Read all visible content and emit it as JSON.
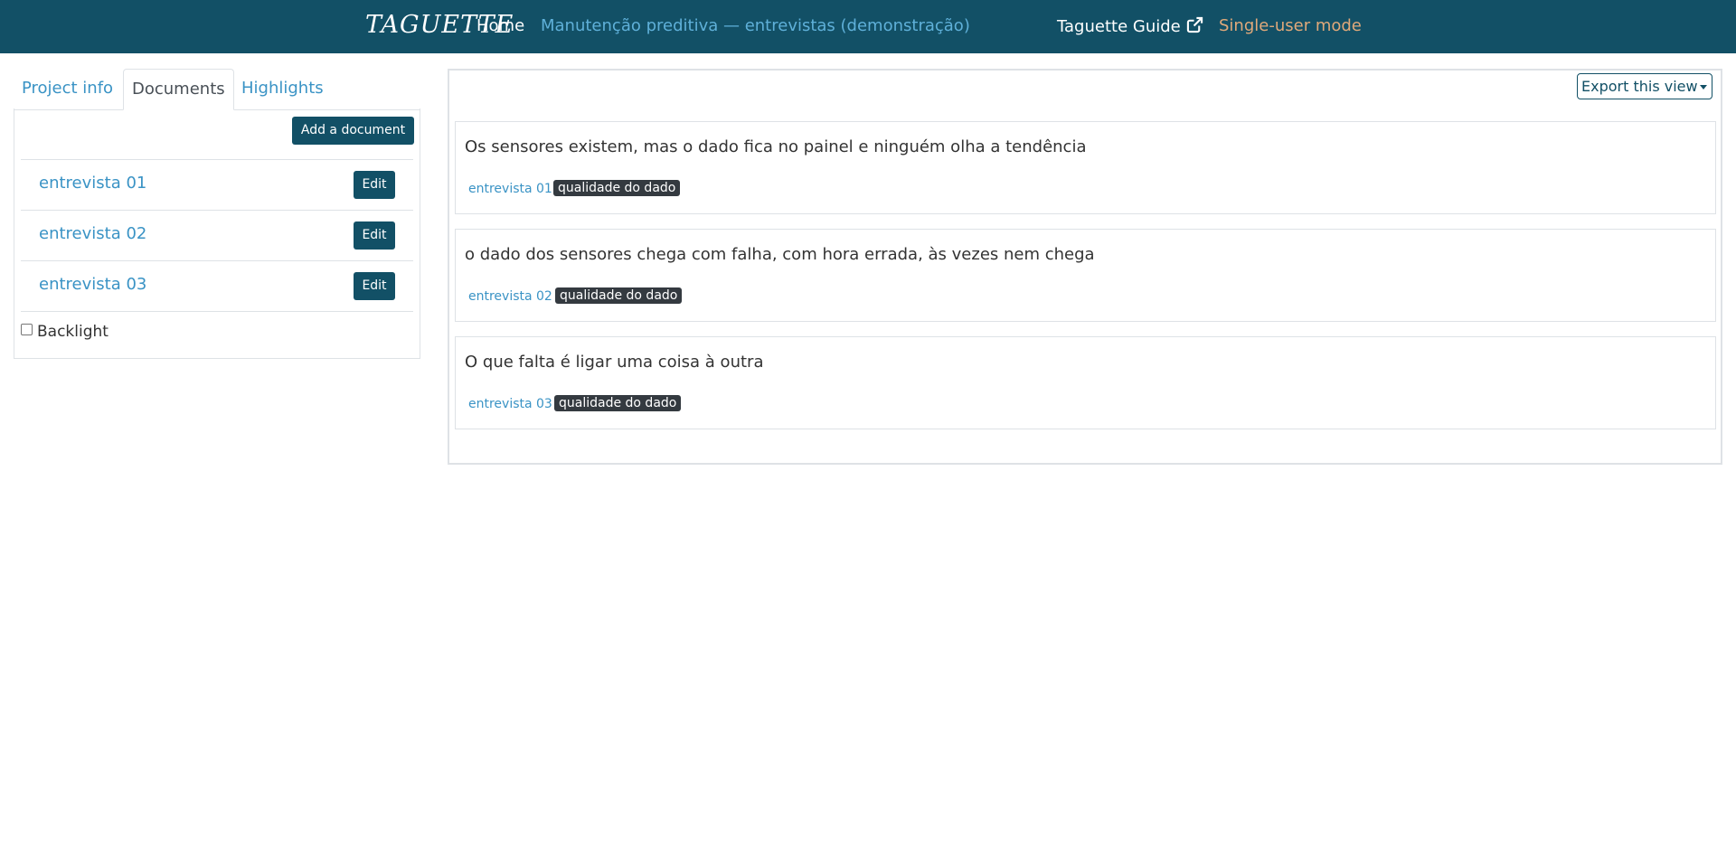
{
  "navbar": {
    "brand": "TAGUETTE",
    "home": "Home",
    "project": "Manutenção preditiva — entrevistas (demonstração)",
    "guide": "Taguette Guide",
    "mode": "Single-user mode"
  },
  "tabs": [
    {
      "label": "Project info"
    },
    {
      "label": "Documents"
    },
    {
      "label": "Highlights"
    }
  ],
  "documents": {
    "add_label": "Add a document",
    "edit_label": "Edit",
    "items": [
      {
        "name": "entrevista 01"
      },
      {
        "name": "entrevista 02"
      },
      {
        "name": "entrevista 03"
      }
    ],
    "backlight_label": "Backlight"
  },
  "main": {
    "export_label": "Export this view",
    "highlights": [
      {
        "text": "Os sensores existem, mas o dado fica no painel e ninguém olha a tendência",
        "document": "entrevista 01",
        "tag": "qualidade do dado"
      },
      {
        "text": "o dado dos sensores chega com falha, com hora errada, às vezes nem chega",
        "document": "entrevista 02",
        "tag": "qualidade do dado"
      },
      {
        "text": "O que falta é ligar uma coisa à outra",
        "document": "entrevista 03",
        "tag": "qualidade do dado"
      }
    ]
  }
}
